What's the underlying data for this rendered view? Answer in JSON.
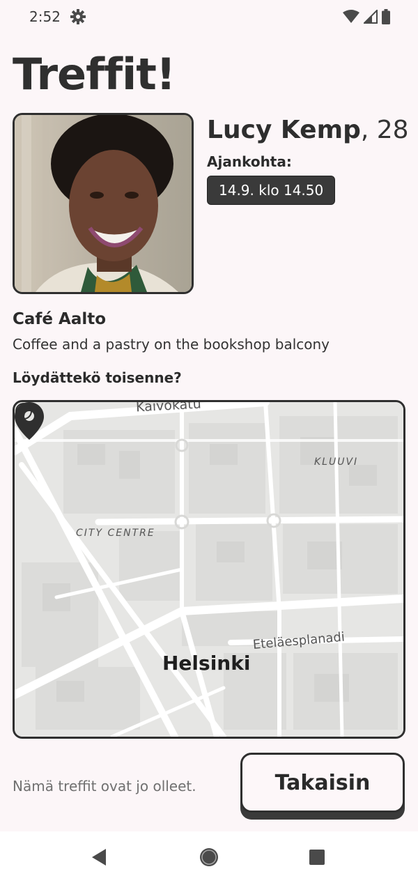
{
  "status_bar": {
    "time": "2:52",
    "icons": [
      "gear-icon",
      "wifi-icon",
      "signal-icon",
      "battery-icon"
    ]
  },
  "title": "Treffit!",
  "profile": {
    "name": "Lucy Kemp",
    "age_text": ", 28",
    "time_label": "Ajankohta:",
    "time_value": "14.9. klo 14.50"
  },
  "venue": {
    "name": "Café Aalto",
    "description": "Coffee and a pastry on the bookshop balcony"
  },
  "found_question": "Löydättekö toisenne?",
  "map": {
    "labels": {
      "kaivokatu": "Kaivokatu",
      "kluuvi": "KLUUVI",
      "city_centre": "CITY CENTRE",
      "esplanadi": "Eteläesplanadi",
      "helsinki": "Helsinki"
    }
  },
  "footer": {
    "past_note": "Nämä treffit ovat jo olleet.",
    "back_label": "Takaisin"
  },
  "colors": {
    "background": "#fcf6f8",
    "text_dark": "#2f2f2f",
    "badge_bg": "#3a3a3a",
    "map_bg": "#e9e9e7"
  }
}
